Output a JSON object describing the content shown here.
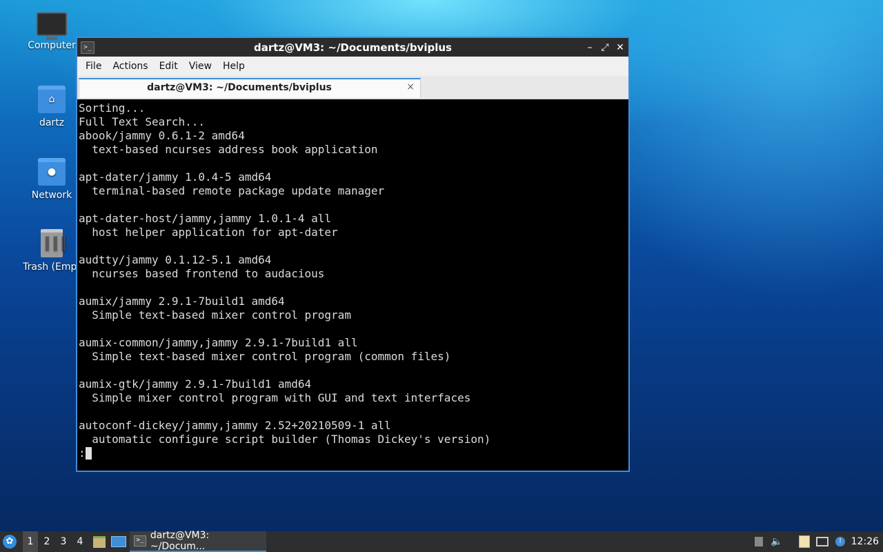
{
  "desktop": {
    "icons": [
      {
        "label": "Computer"
      },
      {
        "label": "dartz"
      },
      {
        "label": "Network"
      },
      {
        "label": "Trash (Empt"
      }
    ]
  },
  "window": {
    "title": "dartz@VM3: ~/Documents/bviplus",
    "controls": {
      "minimize": "–",
      "maximize": "⤢",
      "close": "✕"
    },
    "menu": [
      "File",
      "Actions",
      "Edit",
      "View",
      "Help"
    ],
    "tab": {
      "label": "dartz@VM3: ~/Documents/bviplus",
      "close": "×"
    }
  },
  "terminal": {
    "lines": [
      "Sorting...",
      "Full Text Search...",
      "abook/jammy 0.6.1-2 amd64",
      "  text-based ncurses address book application",
      "",
      "apt-dater/jammy 1.0.4-5 amd64",
      "  terminal-based remote package update manager",
      "",
      "apt-dater-host/jammy,jammy 1.0.1-4 all",
      "  host helper application for apt-dater",
      "",
      "audtty/jammy 0.1.12-5.1 amd64",
      "  ncurses based frontend to audacious",
      "",
      "aumix/jammy 2.9.1-7build1 amd64",
      "  Simple text-based mixer control program",
      "",
      "aumix-common/jammy,jammy 2.9.1-7build1 all",
      "  Simple text-based mixer control program (common files)",
      "",
      "aumix-gtk/jammy 2.9.1-7build1 amd64",
      "  Simple mixer control program with GUI and text interfaces",
      "",
      "autoconf-dickey/jammy,jammy 2.52+20210509-1 all",
      "  automatic configure script builder (Thomas Dickey's version)"
    ],
    "prompt": ":"
  },
  "taskbar": {
    "workspaces": [
      "1",
      "2",
      "3",
      "4"
    ],
    "task_label": "dartz@VM3: ~/Docum...",
    "clock": "12:26"
  },
  "colors": {
    "accent": "#3f8ed8",
    "terminal_bg": "#000000",
    "terminal_fg": "#dcdcdc",
    "taskbar_bg": "#2d2e30"
  }
}
